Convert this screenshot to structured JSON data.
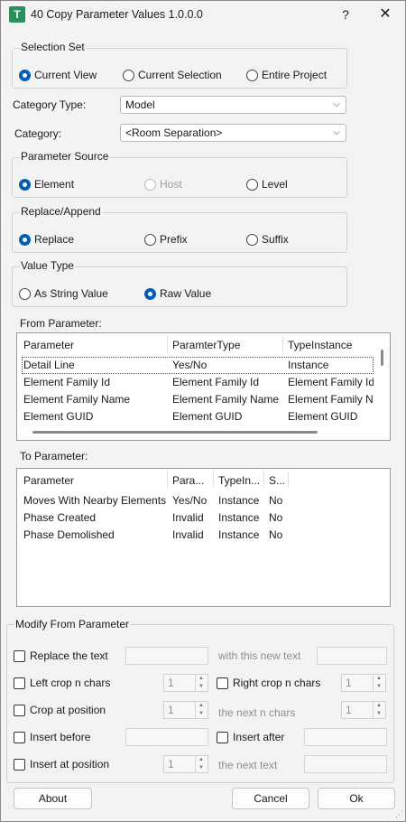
{
  "window": {
    "title": "40 Copy Parameter Values 1.0.0.0",
    "icon_text": "T",
    "help_glyph": "?",
    "close_glyph": "✕"
  },
  "selection_set": {
    "label": "Selection Set",
    "options": [
      "Current View",
      "Current Selection",
      "Entire Project"
    ],
    "selected": "Current View"
  },
  "category_type": {
    "label": "Category Type:",
    "value": "Model"
  },
  "category": {
    "label": "Category:",
    "value": "<Room Separation>"
  },
  "parameter_source": {
    "label": "Parameter Source",
    "options": [
      "Element",
      "Host",
      "Level"
    ],
    "selected": "Element",
    "disabled": [
      "Host"
    ]
  },
  "replace_append": {
    "label": "Replace/Append",
    "options": [
      "Replace",
      "Prefix",
      "Suffix"
    ],
    "selected": "Replace"
  },
  "value_type": {
    "label": "Value Type",
    "options": [
      "As String Value",
      "Raw Value"
    ],
    "selected": "Raw Value"
  },
  "from_parameter": {
    "label": "From Parameter:",
    "columns": [
      "Parameter",
      "ParamterType",
      "TypeInstance"
    ],
    "rows": [
      [
        "Detail Line",
        "Yes/No",
        "Instance"
      ],
      [
        "Element Family Id",
        "Element Family Id",
        "Element Family Id"
      ],
      [
        "Element Family Name",
        "Element Family Name",
        "Element Family Na"
      ],
      [
        "Element GUID",
        "Element GUID",
        "Element GUID"
      ]
    ],
    "selected_row": 0
  },
  "to_parameter": {
    "label": "To Parameter:",
    "columns": [
      "Parameter",
      "Para...",
      "TypeIn...",
      "S..."
    ],
    "rows": [
      [
        "Moves With Nearby Elements",
        "Yes/No",
        "Instance",
        "No"
      ],
      [
        "Phase Created",
        "Invalid",
        "Instance",
        "No"
      ],
      [
        "Phase Demolished",
        "Invalid",
        "Instance",
        "No"
      ]
    ]
  },
  "modify": {
    "label": "Modify From Parameter",
    "replace_text": "Replace the text",
    "with_new_text_hint": "with this new text",
    "left_crop": "Left crop n chars",
    "left_crop_value": "1",
    "right_crop": "Right crop n chars",
    "right_crop_value": "1",
    "crop_at_position": "Crop at position",
    "crop_position_value": "1",
    "next_n_chars_hint": "the next n chars",
    "next_n_chars_value": "1",
    "insert_before": "Insert before",
    "insert_after": "Insert after",
    "insert_at_position": "Insert at position",
    "insert_position_value": "1",
    "next_text_hint": "the next text"
  },
  "buttons": {
    "about": "About",
    "cancel": "Cancel",
    "ok": "Ok"
  },
  "colors": {
    "accent": "#005fb8",
    "icon_green": "#27915e"
  }
}
